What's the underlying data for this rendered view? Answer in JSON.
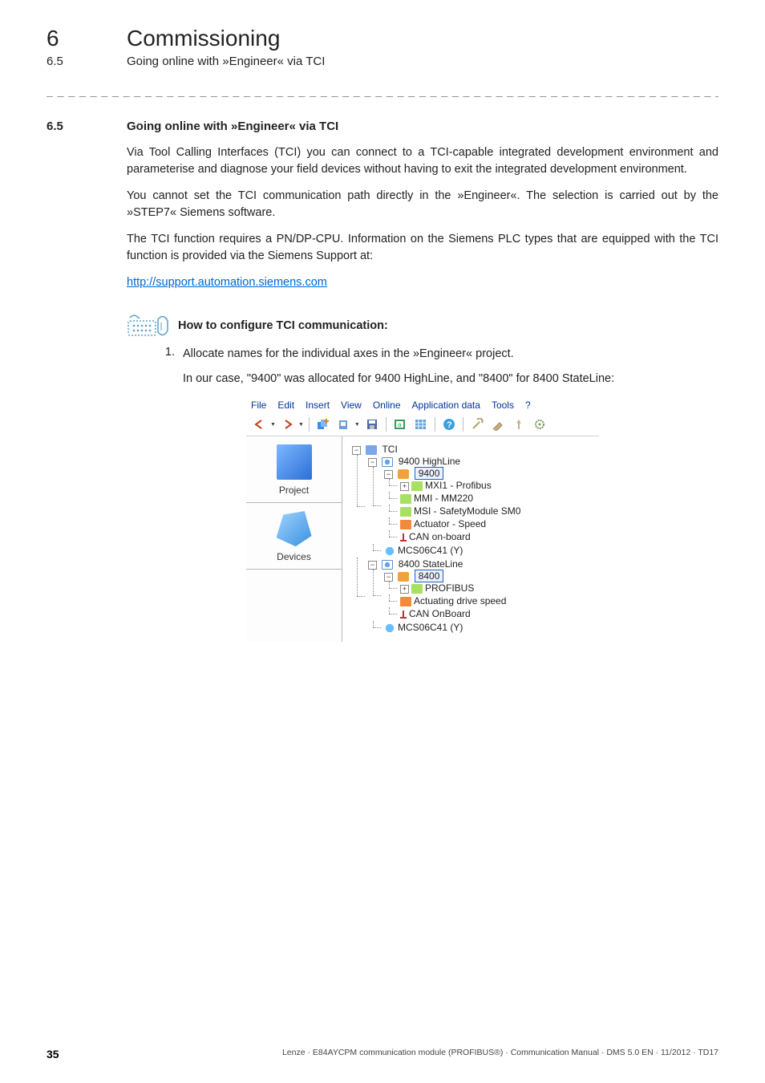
{
  "header": {
    "chapter_number": "6",
    "chapter_title": "Commissioning",
    "sub_number": "6.5",
    "sub_title": "Going online with »Engineer« via TCI"
  },
  "section": {
    "number": "6.5",
    "title": "Going online with »Engineer« via TCI"
  },
  "paragraphs": {
    "p1": "Via Tool Calling Interfaces (TCI) you can connect to a TCI-capable integrated development environment and parameterise and diagnose your field devices without having to exit the integrated development environment.",
    "p2": "You cannot set the TCI communication path directly in the »Engineer«. The selection is carried out by the »STEP7« Siemens software.",
    "p3": "The TCI function requires a PN/DP-CPU. Information on the Siemens PLC types that are equipped with the TCI function is provided via the Siemens Support at:",
    "link": "http://support.automation.siemens.com"
  },
  "howto_label": "How to configure TCI communication:",
  "step": {
    "num": "1.",
    "text": "Allocate names for the individual axes in the »Engineer« project.",
    "sub": "In our case, \"9400\" was allocated for 9400 HighLine, and \"8400\" for 8400 StateLine:"
  },
  "screenshot": {
    "menu": {
      "file": "File",
      "edit": "Edit",
      "insert": "Insert",
      "view": "View",
      "online": "Online",
      "appdata": "Application data",
      "tools": "Tools",
      "help": "?"
    },
    "sidebar": {
      "project": "Project",
      "devices": "Devices"
    },
    "tree": {
      "root": "TCI",
      "n9400hl": "9400 HighLine",
      "n9400": "9400",
      "mxi1": "MXI1 - Profibus",
      "mmi": "MMI - MM220",
      "msi": "MSI - SafetyModule SM0",
      "actuator": "Actuator - Speed",
      "can1": "CAN on-board",
      "mcs1": "MCS06C41 (Y)",
      "n8400sl": "8400 StateLine",
      "n8400": "8400",
      "profibus": "PROFIBUS",
      "act2": "Actuating drive speed",
      "can2": "CAN OnBoard",
      "mcs2": "MCS06C41 (Y)"
    }
  },
  "footer": {
    "page": "35",
    "doc": "Lenze · E84AYCPM communication module (PROFIBUS®) · Communication Manual · DMS 5.0 EN · 11/2012 · TD17"
  },
  "dash_line": "_ _ _ _ _ _ _ _ _ _ _ _ _ _ _ _ _ _ _ _ _ _ _ _ _ _ _ _ _ _ _ _ _ _ _ _ _ _ _ _ _ _ _ _ _ _ _ _ _ _ _ _ _ _ _ _ _ _ _ _ _ _ _ _"
}
